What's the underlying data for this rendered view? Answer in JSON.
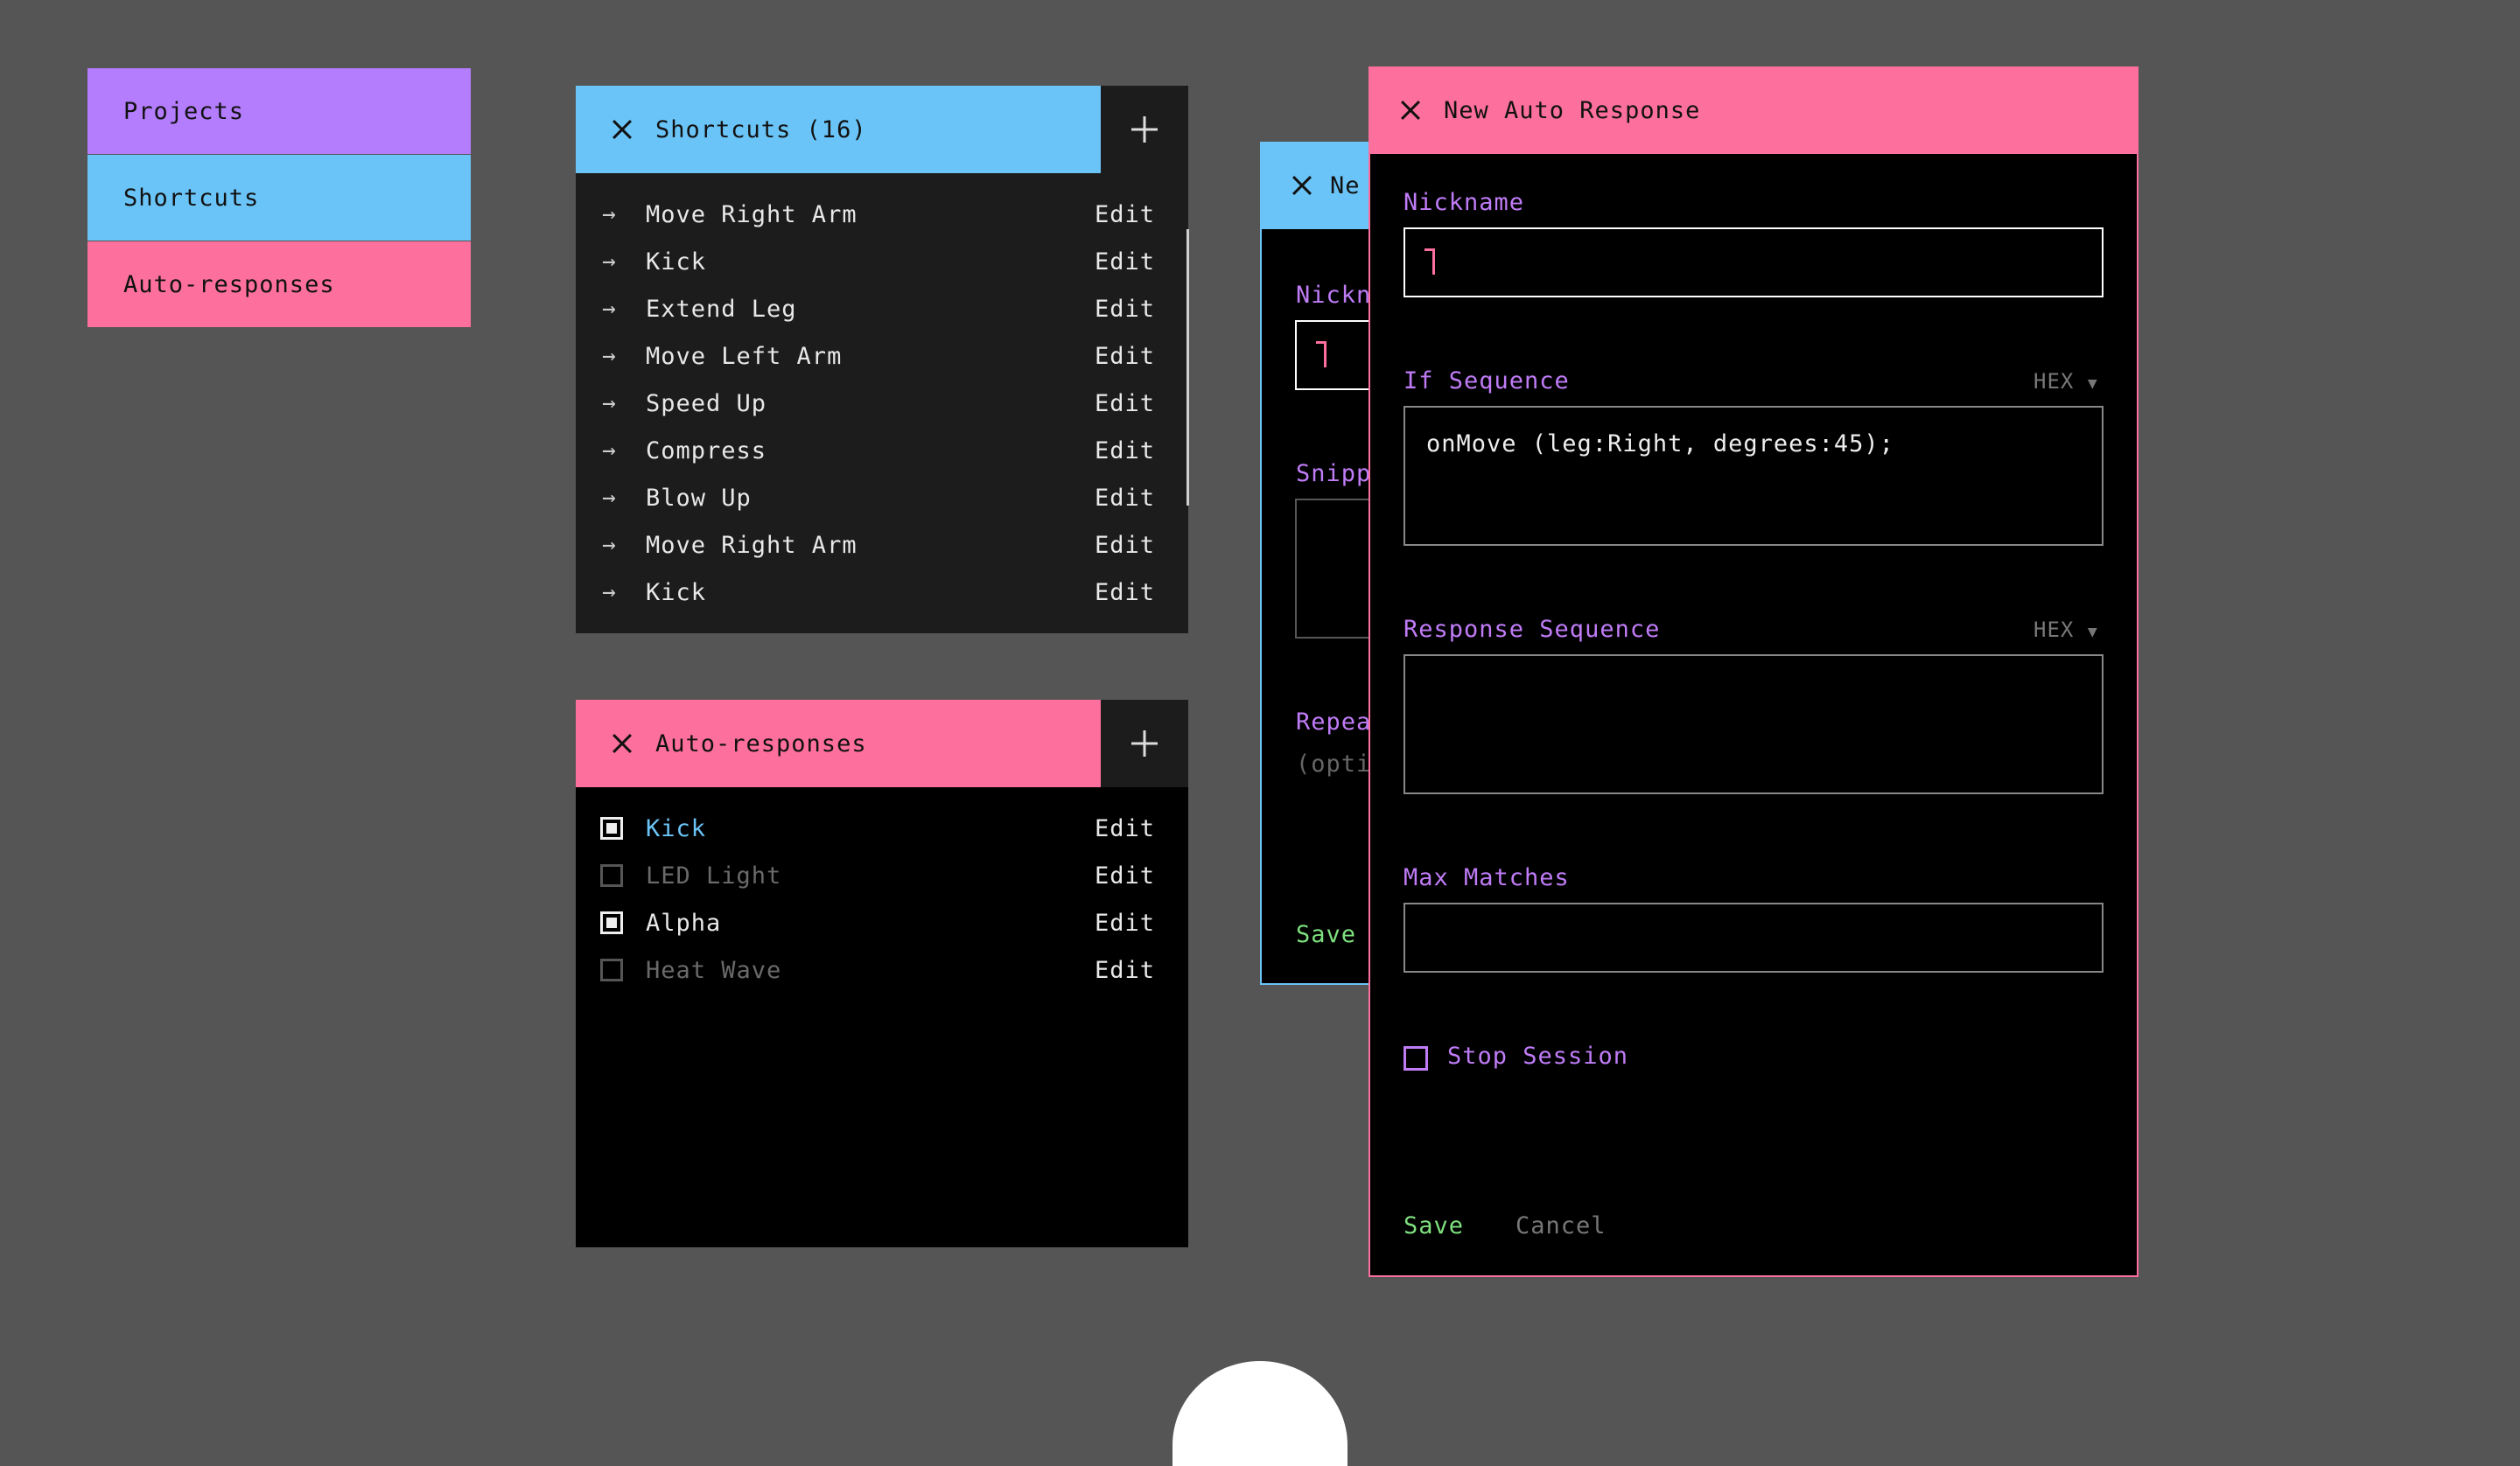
{
  "nav": {
    "projects": "Projects",
    "shortcuts": "Shortcuts",
    "auto_responses": "Auto-responses"
  },
  "shortcuts_panel": {
    "title": "Shortcuts (16)",
    "items": [
      {
        "label": "Move Right Arm",
        "action": "Edit"
      },
      {
        "label": "Kick",
        "action": "Edit"
      },
      {
        "label": "Extend Leg",
        "action": "Edit"
      },
      {
        "label": "Move Left Arm",
        "action": "Edit"
      },
      {
        "label": "Speed Up",
        "action": "Edit"
      },
      {
        "label": "Compress",
        "action": "Edit"
      },
      {
        "label": "Blow Up",
        "action": "Edit"
      },
      {
        "label": "Move Right Arm",
        "action": "Edit"
      },
      {
        "label": "Kick",
        "action": "Edit"
      }
    ]
  },
  "auto_panel": {
    "title": "Auto-responses",
    "items": [
      {
        "label": "Kick",
        "action": "Edit",
        "checked": true
      },
      {
        "label": "LED Light",
        "action": "Edit",
        "checked": false
      },
      {
        "label": "Alpha",
        "action": "Edit",
        "checked": true
      },
      {
        "label": "Heat Wave",
        "action": "Edit",
        "checked": false
      }
    ]
  },
  "back_form": {
    "title": "Ne",
    "nickname_label": "Nickn",
    "snippet_label": "Snipp",
    "repeat_label": "Repea",
    "optional_label": "(opti",
    "save": "Save"
  },
  "auto_form": {
    "title": "New Auto Response",
    "nickname_label": "Nickname",
    "nickname_value": "",
    "if_sequence_label": "If Sequence",
    "if_sequence_format": "HEX",
    "if_sequence_value": "onMove (leg:Right, degrees:45);",
    "response_sequence_label": "Response Sequence",
    "response_sequence_format": "HEX",
    "response_sequence_value": "",
    "max_matches_label": "Max Matches",
    "max_matches_value": "",
    "stop_session_label": "Stop Session",
    "save": "Save",
    "cancel": "Cancel"
  },
  "colors": {
    "background": "#555555",
    "purple": "#b47dfd",
    "blue": "#6bc4f7",
    "pink": "#fd709d",
    "label_purple": "#c07cf7",
    "save_green": "#7ee07e"
  }
}
